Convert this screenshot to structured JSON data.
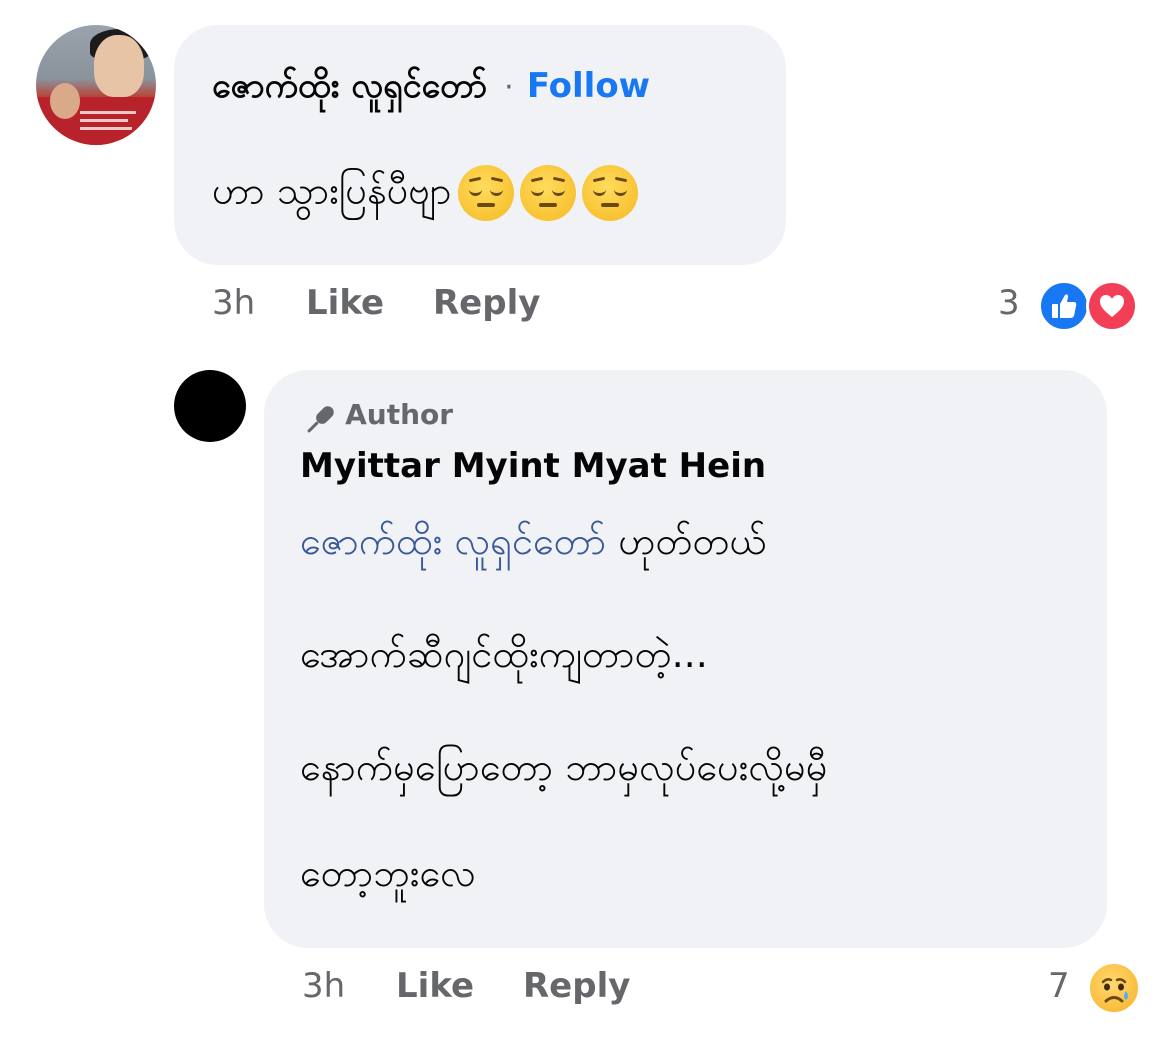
{
  "comment1": {
    "author": "ဇောက်ထိုး လူရှင်တော်",
    "separator": "·",
    "follow_label": "Follow",
    "text": "ဟာ သွားပြန်ပီဗျာ",
    "emoji": [
      "pensive-face-icon",
      "pensive-face-icon",
      "pensive-face-icon"
    ],
    "time": "3h",
    "like_label": "Like",
    "reply_label": "Reply",
    "reaction_count": "3",
    "reactions": [
      "like-icon",
      "love-icon"
    ]
  },
  "comment2": {
    "badge": "Author",
    "author": "Myittar Myint Myat Hein",
    "mention": "ဇောက်ထိုး လူရှင်တော်",
    "line1_rest": " ဟုတ်တယ်",
    "line2": "အောက်ဆီဂျင်ထိုးကျတာတဲ့...",
    "line3": "နောက်မှပြောတော့ ဘာမှလုပ်ပေးလို့မမှီ",
    "line4": "တော့ဘူးလေ",
    "time": "3h",
    "like_label": "Like",
    "reply_label": "Reply",
    "reaction_count": "7",
    "reactions": [
      "sad-icon"
    ]
  },
  "colors": {
    "link": "#1877f2",
    "mention": "#385898",
    "bubble": "#f0f2f5",
    "meta": "#65676b"
  }
}
